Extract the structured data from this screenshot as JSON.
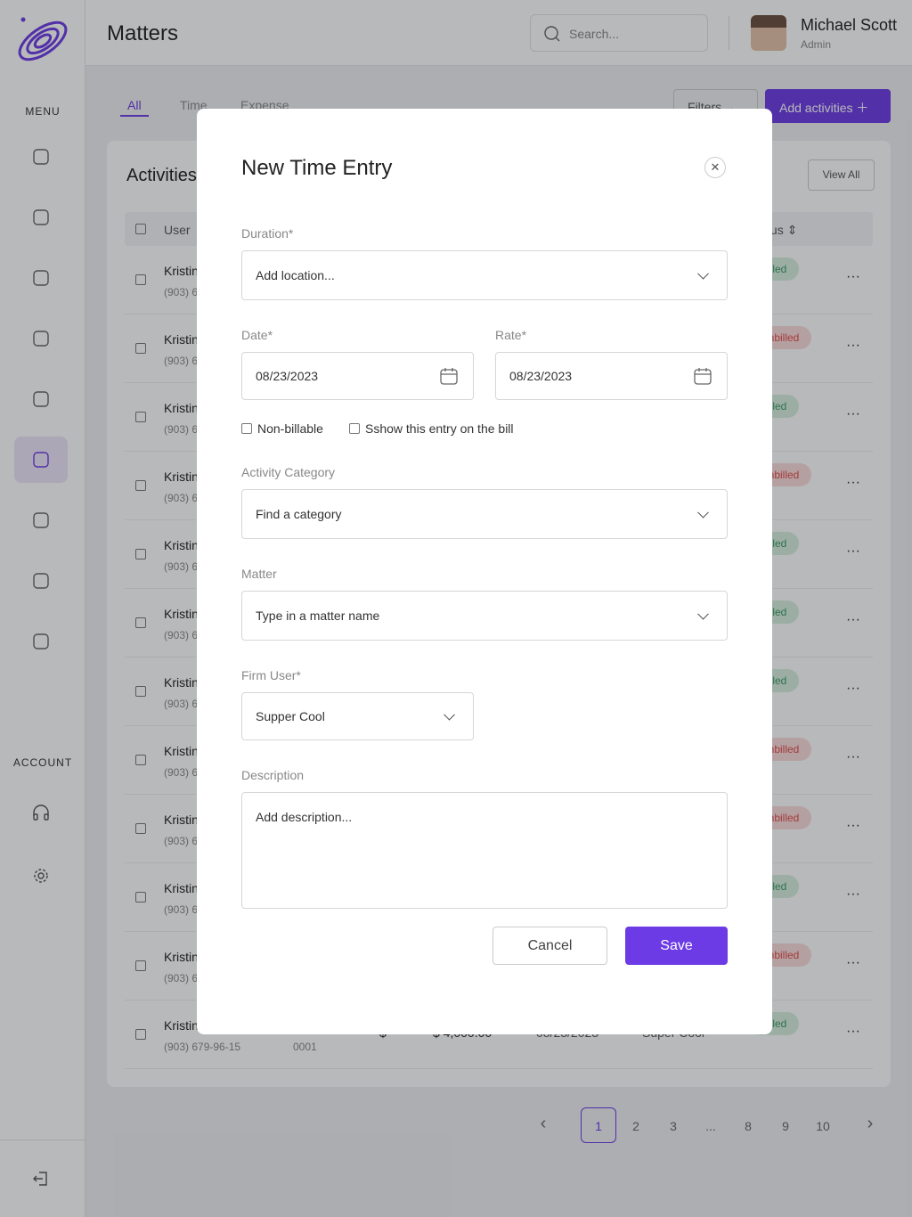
{
  "sidebar": {
    "menu_label": "MENU",
    "account_label": "ACCOUNT",
    "items": [
      "home-icon",
      "calendar-icon",
      "checklist-icon",
      "chat-icon",
      "phone-icon",
      "clock-icon",
      "document-icon",
      "chart-icon",
      "contract-icon"
    ],
    "active_index": 5,
    "account_items": [
      "headphones-icon",
      "gear-icon"
    ],
    "logout": "logout-icon"
  },
  "header": {
    "title": "Matters",
    "search_placeholder": "Search...",
    "user_name": "Michael Scott",
    "user_role": "Admin"
  },
  "tabs": [
    {
      "label": "All",
      "active": true
    },
    {
      "label": "Time"
    },
    {
      "label": "Expense"
    }
  ],
  "toolbar": {
    "filters": "Filters",
    "add": "Add activities"
  },
  "activities": {
    "title": "Activities",
    "view_all": "View All",
    "col_user": "User",
    "col_status": "Status",
    "rows": [
      {
        "name": "Kristin",
        "phone": "(903) 679-96-15",
        "status": "Billed"
      },
      {
        "name": "Kristin",
        "phone": "(903) 679-96-15",
        "status": "Unbilled"
      },
      {
        "name": "Kristin",
        "phone": "(903) 679-96-15",
        "status": "Billed"
      },
      {
        "name": "Kristin",
        "phone": "(903) 679-96-15",
        "status": "Unbilled"
      },
      {
        "name": "Kristin",
        "phone": "(903) 679-96-15",
        "status": "Billed"
      },
      {
        "name": "Kristin",
        "phone": "(903) 679-96-15",
        "status": "Billed"
      },
      {
        "name": "Kristin",
        "phone": "(903) 679-96-15",
        "status": "Billed"
      },
      {
        "name": "Kristin",
        "phone": "(903) 679-96-15",
        "status": "Unbilled"
      },
      {
        "name": "Kristin",
        "phone": "(903) 679-96-15",
        "status": "Unbilled"
      },
      {
        "name": "Kristin",
        "phone": "(903) 679-96-15",
        "status": "Billed"
      },
      {
        "name": "Kristin",
        "phone": "(903) 679-96-15",
        "status": "Unbilled"
      },
      {
        "name": "Kristin",
        "phone": "(903) 679-96-15",
        "status": "Billed",
        "matter": "0001",
        "currency": "$",
        "amount": "$ 4,000.00",
        "date": "08/23/2023",
        "firm_user": "Super Cool"
      }
    ]
  },
  "pagination": {
    "pages": [
      "1",
      "2",
      "3",
      "...",
      "8",
      "9",
      "10"
    ],
    "current": "1"
  },
  "modal": {
    "title": "New Time Entry",
    "duration_label": "Duration*",
    "duration_placeholder": "Add location...",
    "date_label": "Date*",
    "date_value": "08/23/2023",
    "rate_label": "Rate*",
    "rate_value": "08/23/2023",
    "non_billable": "Non-billable",
    "show_on_bill": "Sshow this entry on the bill",
    "category_label": "Activity Category",
    "category_placeholder": "Find a category",
    "matter_label": "Matter",
    "matter_placeholder": "Type in a matter name",
    "firm_user_label": "Firm User*",
    "firm_user_value": "Supper Cool",
    "description_label": "Description",
    "description_placeholder": "Add description...",
    "cancel": "Cancel",
    "save": "Save"
  },
  "colors": {
    "accent": "#6d3be6",
    "billed": "#3c9a62",
    "unbilled": "#e24848"
  }
}
